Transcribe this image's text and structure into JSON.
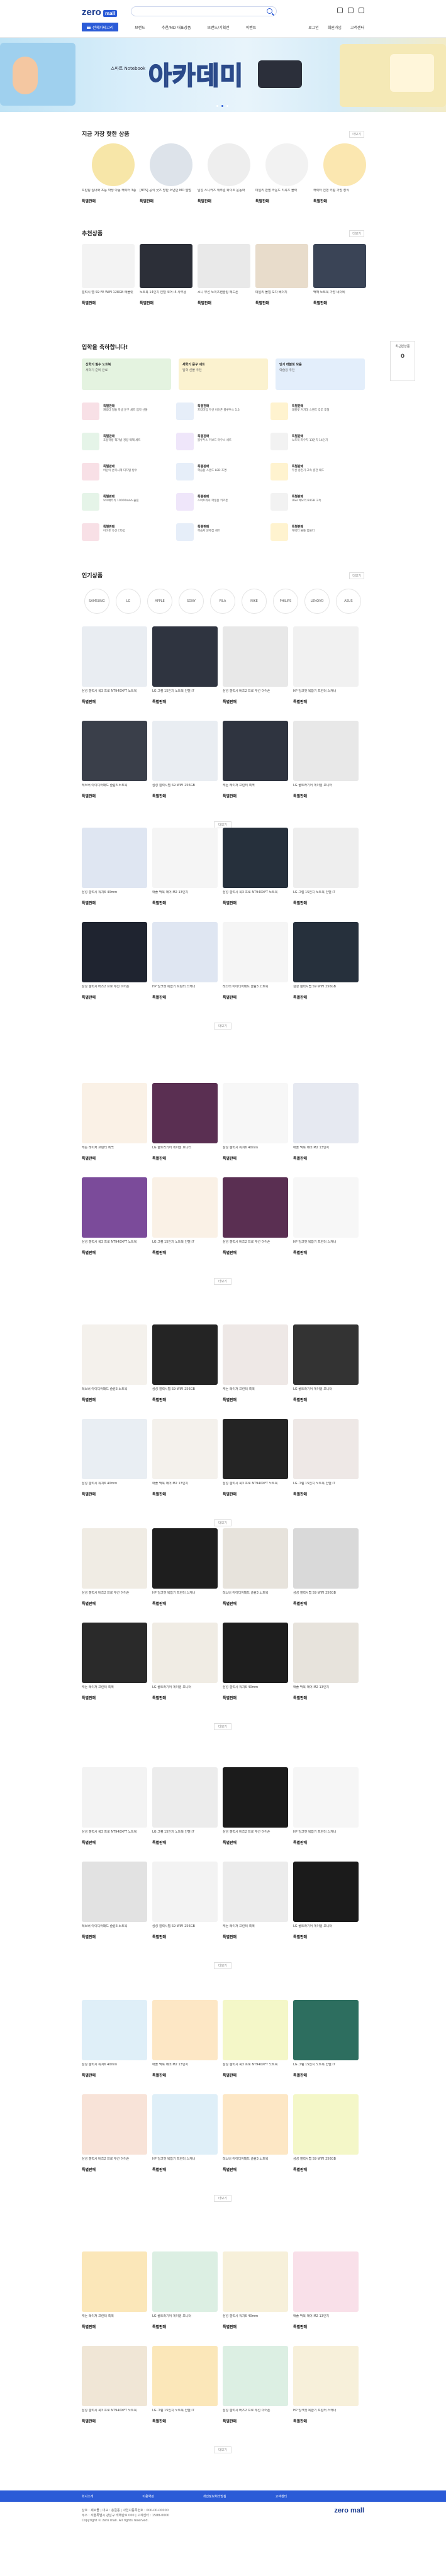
{
  "header": {
    "search_placeholder": "",
    "category_button": "전체카테고리",
    "nav": [
      "브랜드",
      "추천/MD 대표상품",
      "브랜드/기획전",
      "이벤트"
    ],
    "nav_right": [
      "로그인",
      "회원가입",
      "고객센터"
    ]
  },
  "banner": {
    "headline": "스마트 Notebook",
    "big": "아카데미"
  },
  "sections": {
    "popular": {
      "title": "지금 가장 핫한 상품",
      "more": "더보기"
    },
    "recommend": {
      "title": "추천상품",
      "more": "더보기"
    },
    "celebrate": {
      "title": "입학을 축하합니다!"
    },
    "ranking": {
      "title": "인기상품",
      "more": "더보기"
    }
  },
  "price_label": "특별판매",
  "page_more": "더보기",
  "popular_items": [
    "프린팅 실내화 초등 학생 아동 캐릭터 3종",
    "[BTS] 공식 굿즈 방탄 소년단 MD 앨범",
    "남성 스니커즈 캐주얼 화이트 운동화",
    "데일리 반팔 라운드 티셔츠 블랙",
    "캐릭터 인형 키링 가방 장식"
  ],
  "recommend_items": [
    "갤럭시 탭 S9 FE WIFI 128GB 태블릿",
    "노트북 14인치 인텔 코어 i5 사무용",
    "소니 무선 노이즈캔슬링 헤드폰",
    "데일리 볼캡 모자 베이지",
    "백팩 노트북 가방 네이비"
  ],
  "promos": [
    {
      "title": "신학기 필수 노트북",
      "sub": "새학기 준비 완료"
    },
    {
      "title": "새학기 문구 세트",
      "sub": "입학 선물 추천"
    },
    {
      "title": "인기 태블릿 모음",
      "sub": "학습용 추천"
    }
  ],
  "mini_items": [
    {
      "t": "특별판매",
      "d": "캐릭터 필통 학생 문구 세트 입학 선물"
    },
    {
      "t": "특별판매",
      "d": "프리미엄 무선 이어폰 블루투스 5.3"
    },
    {
      "t": "특별판매",
      "d": "태블릿 거치대 스탠드 각도 조절"
    },
    {
      "t": "특별판매",
      "d": "초등학생 책가방 경량 백팩 세트"
    },
    {
      "t": "특별판매",
      "d": "블루투스 키보드 마우스 세트"
    },
    {
      "t": "특별판매",
      "d": "노트북 파우치 13인치 14인치"
    },
    {
      "t": "특별판매",
      "d": "어린이 손목시계 디지털 방수"
    },
    {
      "t": "특별판매",
      "d": "학습용 스탠드 LED 조명"
    },
    {
      "t": "특별판매",
      "d": "무선 충전기 고속 충전 패드"
    },
    {
      "t": "특별판매",
      "d": "보조배터리 10000mAh 슬림"
    },
    {
      "t": "특별판매",
      "d": "스마트워치 학생용 키즈폰"
    },
    {
      "t": "특별판매",
      "d": "USB 메모리 64GB 고속"
    },
    {
      "t": "특별판매",
      "d": "이어폰 유선 C타입"
    },
    {
      "t": "특별판매",
      "d": "학습지 문제집 세트"
    },
    {
      "t": "특별판매",
      "d": "캐릭터 물통 텀블러"
    }
  ],
  "brands": [
    "SAMSUNG",
    "LG",
    "APPLE",
    "SONY",
    "FILA",
    "NIKE",
    "PHILIPS",
    "LENOVO",
    "ASUS"
  ],
  "grid_products": [
    "삼성 갤럭시 북3 프로 NT940XFT 노트북",
    "LG 그램 15인치 노트북 인텔 i7",
    "삼성 갤럭시 버즈2 프로 무선 이어폰",
    "HP 잉크젯 복합기 프린터 스캐너",
    "레노버 아이디어패드 슬림3 노트북",
    "삼성 갤럭시탭 S9 WIFI 256GB",
    "캐논 레이저 프린터 흑백",
    "LG 울트라기어 게이밍 모니터",
    "삼성 갤럭시 워치6 40mm",
    "애플 맥북 에어 M2 13인치"
  ],
  "side_widget": {
    "title": "최근본상품",
    "count": "0"
  },
  "footer": {
    "links": [
      "회사소개",
      "이용약관",
      "개인정보처리방침",
      "고객센터"
    ],
    "info1": "상호 : 제로몰 | 대표 : 홍길동 | 사업자등록번호 : 000-00-00000",
    "info2": "주소 : 서울특별시 강남구 테헤란로 000 | 고객센터 : 1588-0000",
    "copyright": "Copyright © zero mall. All rights reserved."
  }
}
